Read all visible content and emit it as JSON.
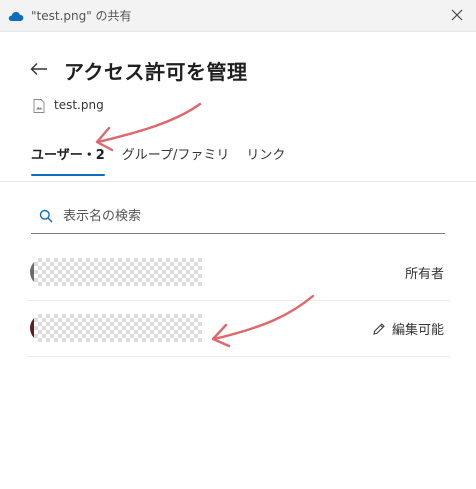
{
  "window": {
    "title": "\"test.png\" の共有"
  },
  "header": {
    "title": "アクセス許可を管理"
  },
  "file": {
    "name": "test.png"
  },
  "tabs": [
    {
      "label": "ユーザー・2",
      "active": true
    },
    {
      "label": "グループ/ファミリ",
      "active": false
    },
    {
      "label": "リンク",
      "active": false
    }
  ],
  "search": {
    "placeholder": "表示名の検索"
  },
  "members": [
    {
      "role": "所有者",
      "name_redacted": true
    },
    {
      "role": "編集可能",
      "name_redacted": true,
      "role_icon": "pencil-icon"
    }
  ],
  "icons": [
    "onedrive-cloud-icon",
    "close-icon",
    "back-arrow-icon",
    "image-file-icon",
    "search-icon",
    "pencil-icon"
  ],
  "colors": {
    "accent": "#0f6cbd",
    "annotation": "#e0666a"
  }
}
